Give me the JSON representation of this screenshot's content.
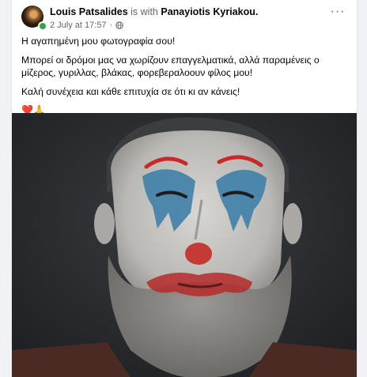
{
  "post": {
    "author": "Louis Patsalides",
    "with_text": "is with",
    "tagged": "Panayiotis Kyriakou.",
    "timestamp": "2 July at 17:57",
    "separator": "·",
    "privacy_icon": "globe-icon",
    "more_icon": "more-options-icon",
    "more_glyph": "···",
    "paragraphs": [
      "Η αγαπημένη μου φωτογραφία σου!",
      "Μπορεί οι δρόμοι μας να χωρίζουν επαγγελματικά, αλλά παραμένεις ο μίζερος, γυριλλας, βλάκας, φορεβεραλοουν φίλος μου!",
      "Καλή συνέχεια και κάθε επιτυχία σε ότι κι αν κάνεις!"
    ],
    "emojis": "❤️🙏",
    "image_icon": "photo-icon"
  },
  "colors": {
    "online": "#31a24c",
    "secondary_text": "#65676b",
    "background": "#f0f2f5"
  }
}
